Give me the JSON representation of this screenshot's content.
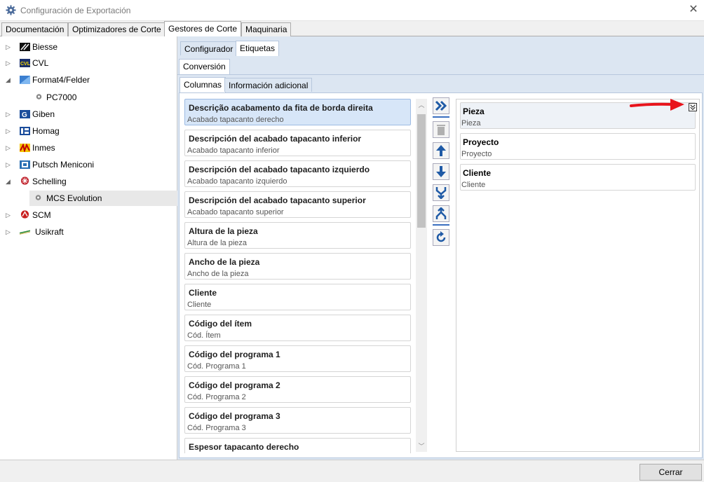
{
  "window": {
    "title": "Configuración de Exportación",
    "close_glyph": "✕"
  },
  "top_tabs": [
    "Documentación",
    "Optimizadores de Corte",
    "Gestores de Corte",
    "Maquinaria"
  ],
  "tree": [
    {
      "label": "Biesse",
      "icon": "biesse-icon"
    },
    {
      "label": "CVL",
      "icon": "cvl-icon"
    },
    {
      "label": "Format4/Felder",
      "icon": "format4-icon"
    },
    {
      "label": "PC7000",
      "icon": "gear-icon"
    },
    {
      "label": "Giben",
      "icon": "giben-icon"
    },
    {
      "label": "Homag",
      "icon": "homag-icon"
    },
    {
      "label": "Inmes",
      "icon": "inmes-icon"
    },
    {
      "label": "Putsch Meniconi",
      "icon": "putsch-icon"
    },
    {
      "label": "Schelling",
      "icon": "schelling-icon"
    },
    {
      "label": "MCS Evolution",
      "icon": "gear-icon"
    },
    {
      "label": "SCM",
      "icon": "scm-icon"
    },
    {
      "label": "Usikraft",
      "icon": "usikraft-icon"
    }
  ],
  "subtabs": {
    "configurador": "Configurador",
    "etiquetas": "Etiquetas",
    "conversion": "Conversión",
    "columnas": "Columnas",
    "info": "Información adicional"
  },
  "left_list": [
    {
      "title": "Descrição acabamento da fita de borda direita",
      "sub": "Acabado tapacanto derecho"
    },
    {
      "title": "Descripción del acabado tapacanto inferior",
      "sub": "Acabado tapacanto inferior"
    },
    {
      "title": "Descripción del acabado tapacanto izquierdo",
      "sub": "Acabado tapacanto izquierdo"
    },
    {
      "title": "Descripción del acabado tapacanto superior",
      "sub": "Acabado tapacanto superior"
    },
    {
      "title": "Altura de la pieza",
      "sub": "Altura de la pieza"
    },
    {
      "title": "Ancho de la pieza",
      "sub": "Ancho de la pieza"
    },
    {
      "title": "Cliente",
      "sub": "Cliente"
    },
    {
      "title": "Código del ítem",
      "sub": "Cód. Ítem"
    },
    {
      "title": "Código del programa 1",
      "sub": "Cód. Programa 1"
    },
    {
      "title": "Código del programa 2",
      "sub": "Cód. Programa 2"
    },
    {
      "title": "Código del programa 3",
      "sub": "Cód. Programa 3"
    },
    {
      "title": "Espesor tapacanto derecho",
      "sub": ""
    }
  ],
  "right_list": [
    {
      "title": "Pieza",
      "sub": "Pieza"
    },
    {
      "title": "Proyecto",
      "sub": "Proyecto"
    },
    {
      "title": "Cliente",
      "sub": "Cliente"
    }
  ],
  "buttons": {
    "close": "Cerrar"
  },
  "colors": {
    "accent": "#3a6fbf",
    "selected": "#d7e6f8",
    "arrow_annotation": "#e8141c"
  }
}
